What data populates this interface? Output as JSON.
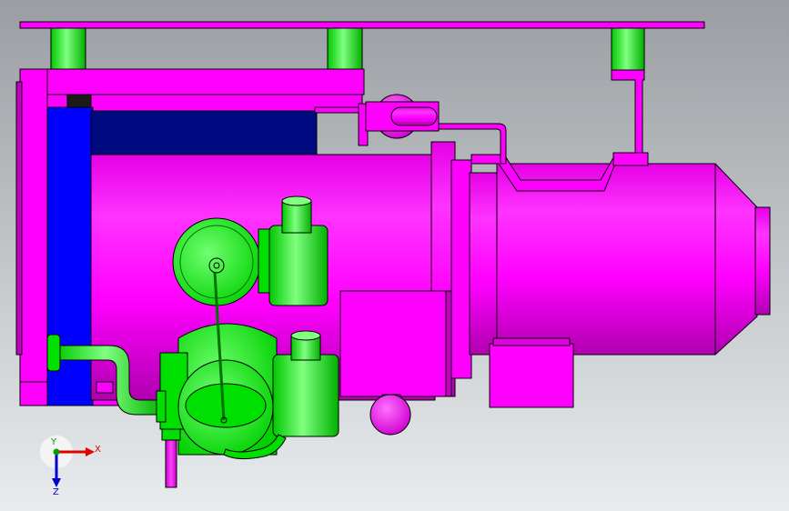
{
  "viewport": {
    "background_top": "#9a9ea2",
    "background_bottom": "#e9ecef"
  },
  "model": {
    "colors": {
      "magenta": "#ff00ff",
      "magenta_shade": "#c400c4",
      "green": "#00ff00",
      "green_shade": "#00b800",
      "blue": "#0000ff",
      "navy": "#000a80",
      "edge": "#000000"
    }
  },
  "triad": {
    "x_label": "X",
    "y_label": "Y",
    "z_label": "Z",
    "x_color": "#e00000",
    "y_color": "#00a000",
    "z_color": "#0000d0"
  }
}
